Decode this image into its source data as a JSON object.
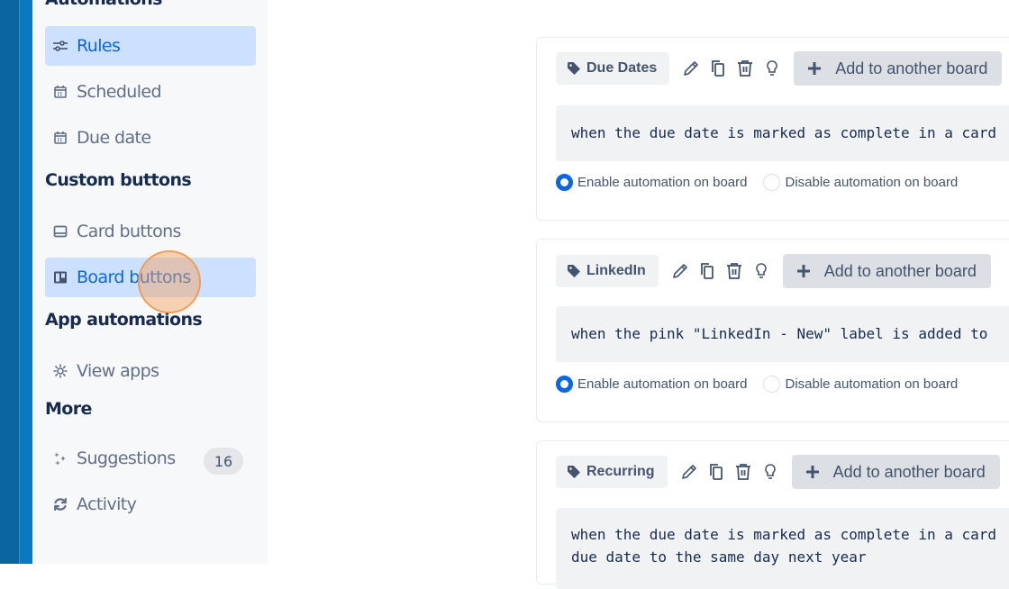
{
  "sidebar": {
    "sections": {
      "automations": "Automations",
      "custom_buttons": "Custom buttons",
      "app_automations": "App automations",
      "more": "More"
    },
    "items": [
      {
        "label": "Rules",
        "icon": "sliders-icon",
        "active": true
      },
      {
        "label": "Scheduled",
        "icon": "calendar-icon",
        "active": false
      },
      {
        "label": "Due date",
        "icon": "calendar-icon",
        "active": false
      },
      {
        "label": "Card buttons",
        "icon": "card-icon",
        "active": false
      },
      {
        "label": "Board buttons",
        "icon": "board-icon",
        "active": true
      },
      {
        "label": "View apps",
        "icon": "gear-icon",
        "active": false
      },
      {
        "label": "Suggestions",
        "icon": "sparkle-icon",
        "active": false,
        "badge": "16"
      },
      {
        "label": "Activity",
        "icon": "refresh-icon",
        "active": false
      }
    ]
  },
  "rules": [
    {
      "tag": "Due Dates",
      "add_label": "Add to another board",
      "text": "when the due date is marked as complete in a card",
      "enable_label": "Enable automation on board",
      "disable_label": "Disable automation on board",
      "enabled": true
    },
    {
      "tag": "LinkedIn",
      "add_label": "Add to another board",
      "text": "when the pink \"LinkedIn - New\" label is added to",
      "enable_label": "Enable automation on board",
      "disable_label": "Disable automation on board",
      "enabled": true
    },
    {
      "tag": "Recurring",
      "add_label": "Add to another board",
      "text": "when the due date is marked as complete in a card",
      "text2": "due date to the same day next year"
    }
  ],
  "colors": {
    "accent": "#0c66e4",
    "active_bg": "#cce0ff",
    "rail_dark": "#0a64a0",
    "rail_light": "#0b79bf"
  }
}
